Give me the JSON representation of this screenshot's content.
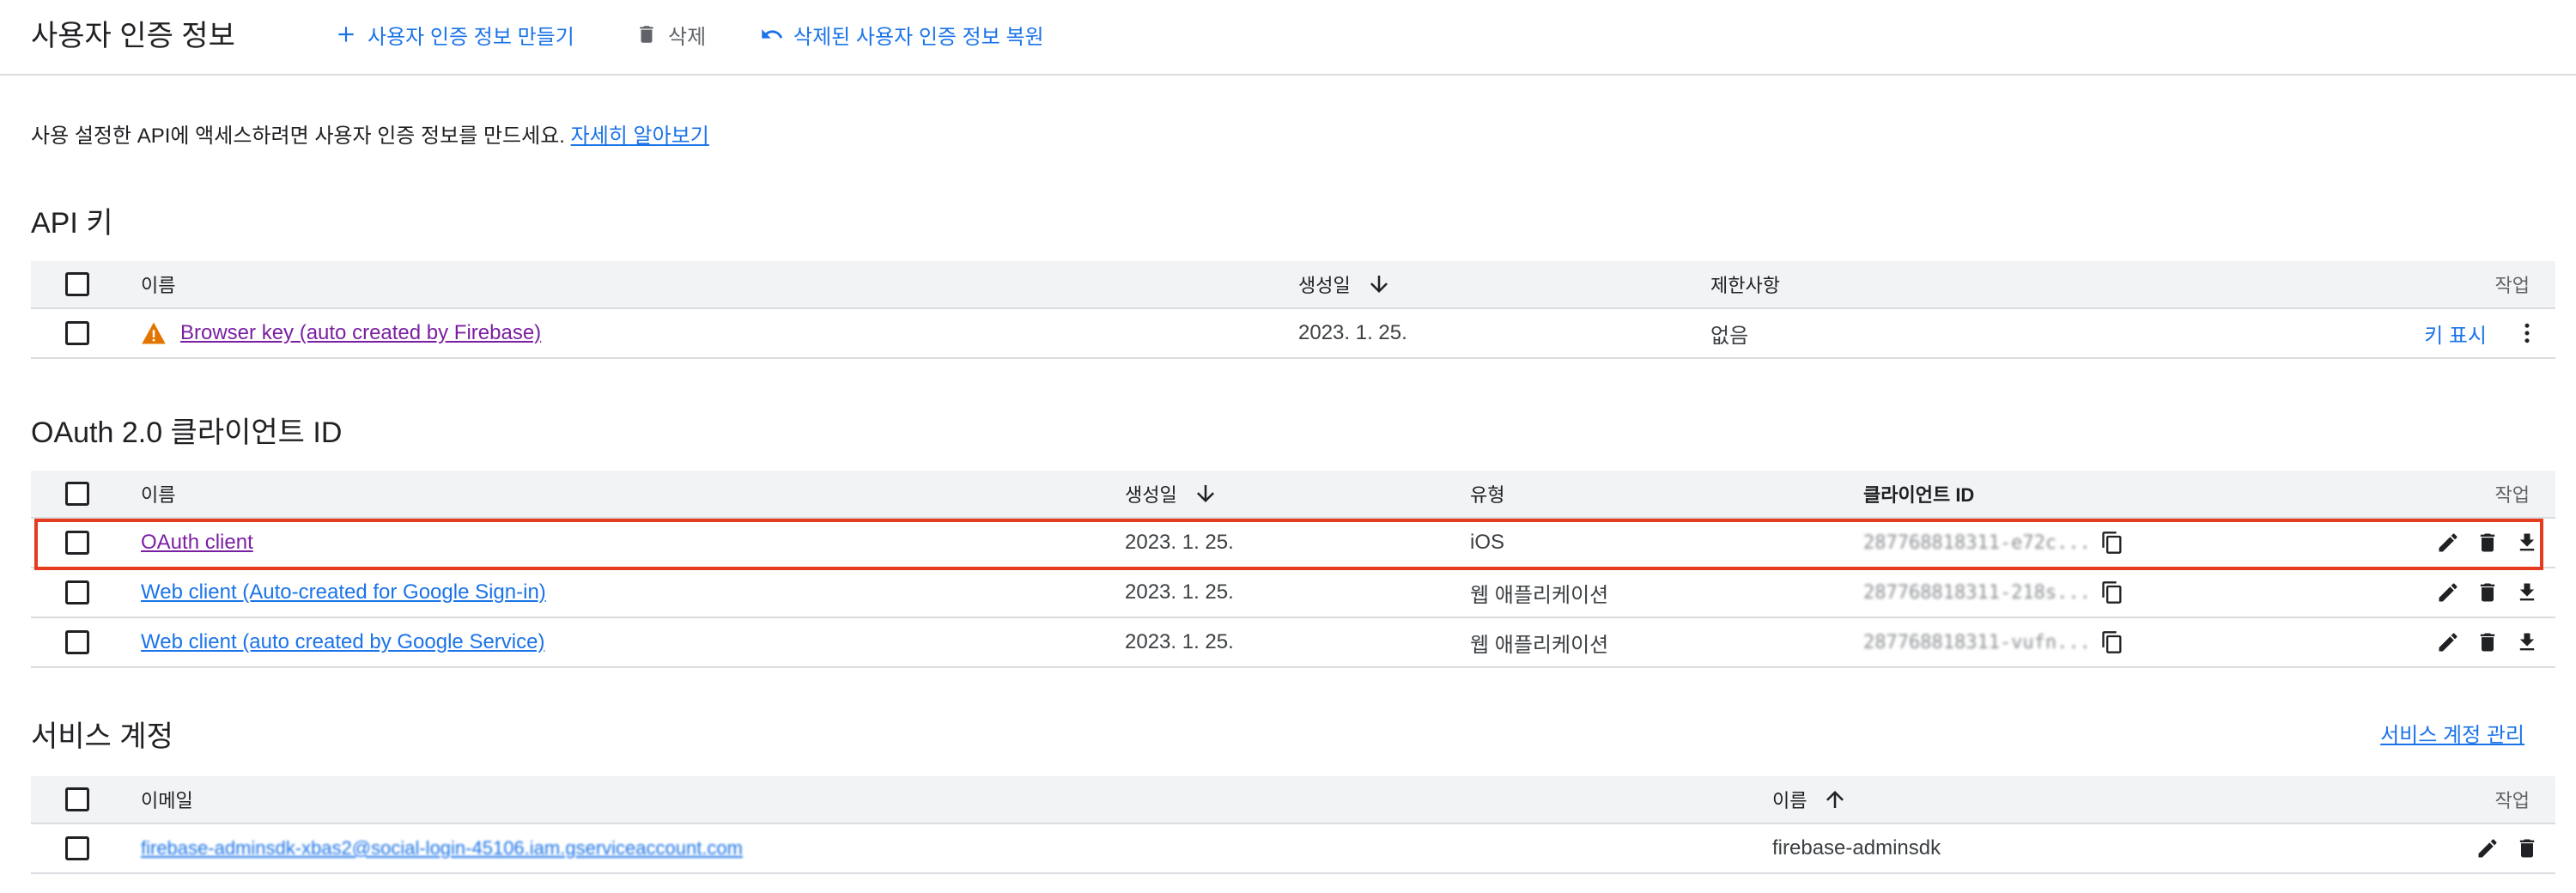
{
  "header": {
    "title": "사용자 인증 정보",
    "create_label": "사용자 인증 정보 만들기",
    "delete_label": "삭제",
    "restore_label": "삭제된 사용자 인증 정보 복원"
  },
  "intro": {
    "text": "사용 설정한 API에 액세스하려면 사용자 인증 정보를 만드세요.",
    "link": "자세히 알아보기"
  },
  "api_keys": {
    "title": "API 키",
    "columns": {
      "name": "이름",
      "created": "생성일",
      "restrictions": "제한사항",
      "actions": "작업"
    },
    "rows": [
      {
        "name": "Browser key (auto created by Firebase)",
        "created": "2023. 1. 25.",
        "restrictions": "없음",
        "show_key": "키 표시"
      }
    ]
  },
  "oauth": {
    "title": "OAuth 2.0 클라이언트 ID",
    "columns": {
      "name": "이름",
      "created": "생성일",
      "type": "유형",
      "client_id": "클라이언트 ID",
      "actions": "작업"
    },
    "rows": [
      {
        "name": "OAuth client",
        "created": "2023. 1. 25.",
        "type": "iOS",
        "client_id": "287768818311-e72c..."
      },
      {
        "name": "Web client (Auto-created for Google Sign-in)",
        "created": "2023. 1. 25.",
        "type": "웹 애플리케이션",
        "client_id": "287768818311-218s..."
      },
      {
        "name": "Web client (auto created by Google Service)",
        "created": "2023. 1. 25.",
        "type": "웹 애플리케이션",
        "client_id": "287768818311-vufn..."
      }
    ]
  },
  "service_accounts": {
    "title": "서비스 계정",
    "manage_label": "서비스 계정 관리",
    "columns": {
      "email": "이메일",
      "name": "이름",
      "actions": "작업"
    },
    "rows": [
      {
        "email": "firebase-adminsdk-xbas2@social-login-45106.iam.gserviceaccount.com",
        "name": "firebase-adminsdk"
      }
    ]
  },
  "colors": {
    "link_blue": "#1a73e8",
    "link_visited": "#7b1fa2",
    "warning": "#e37400",
    "highlight_border": "#e53b1f",
    "header_bg": "#f1f3f4"
  }
}
